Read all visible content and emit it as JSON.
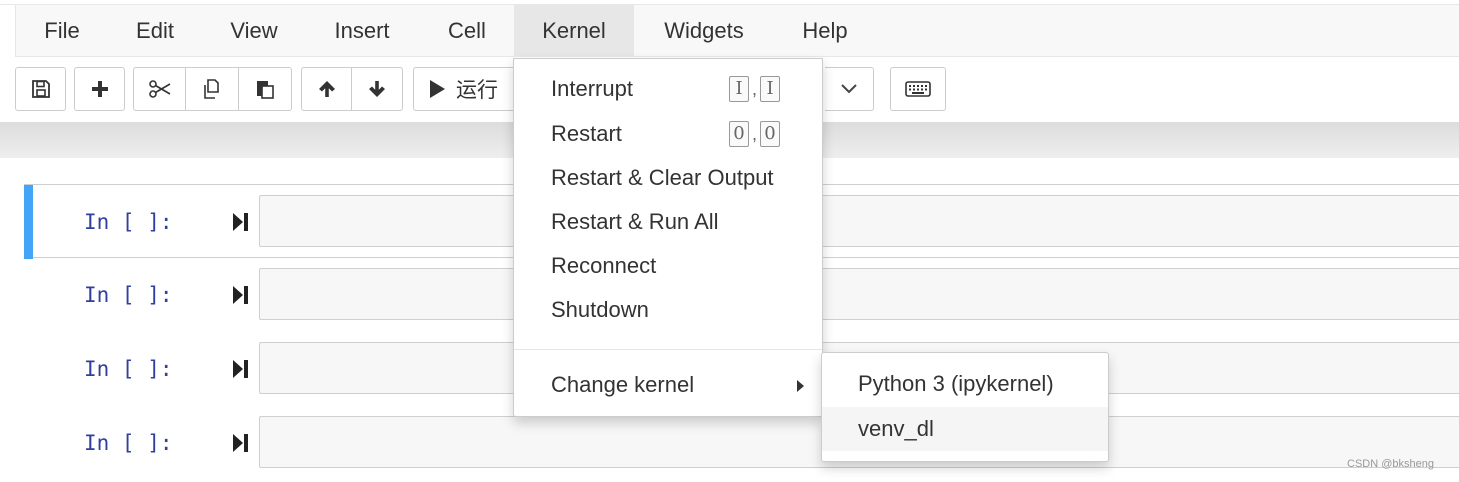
{
  "menubar": {
    "items": [
      {
        "label": "File"
      },
      {
        "label": "Edit"
      },
      {
        "label": "View"
      },
      {
        "label": "Insert"
      },
      {
        "label": "Cell"
      },
      {
        "label": "Kernel"
      },
      {
        "label": "Widgets"
      },
      {
        "label": "Help"
      }
    ],
    "active": "Kernel"
  },
  "toolbar": {
    "save_icon": "floppy-disk-icon",
    "add_icon": "plus-icon",
    "cut_icon": "scissors-icon",
    "copy_icon": "copy-icon",
    "paste_icon": "paste-icon",
    "up_icon": "arrow-up-icon",
    "down_icon": "arrow-down-icon",
    "run_label": "运行",
    "keyboard_icon": "keyboard-icon"
  },
  "cells": [
    {
      "prompt": "In [ ]:",
      "selected": true
    },
    {
      "prompt": "In [ ]:",
      "selected": false
    },
    {
      "prompt": "In [ ]:",
      "selected": false
    },
    {
      "prompt": "In [ ]:",
      "selected": false
    }
  ],
  "kernel_menu": {
    "items": [
      {
        "label": "Interrupt",
        "shortcut": [
          "I",
          "I"
        ]
      },
      {
        "label": "Restart",
        "shortcut": [
          "0",
          "0"
        ]
      },
      {
        "label": "Restart & Clear Output"
      },
      {
        "label": "Restart & Run All"
      },
      {
        "label": "Reconnect"
      },
      {
        "label": "Shutdown"
      }
    ],
    "change_kernel": "Change kernel",
    "kernels": [
      {
        "label": "Python 3 (ipykernel)"
      },
      {
        "label": "venv_dl"
      }
    ],
    "hovered_kernel": "venv_dl"
  },
  "shortcut_separator": ",",
  "watermark": "CSDN @bksheng",
  "colors": {
    "selected_bar": "#42a5f5",
    "prompt": "#303f9f",
    "menubar_bg": "#f8f8f8"
  }
}
